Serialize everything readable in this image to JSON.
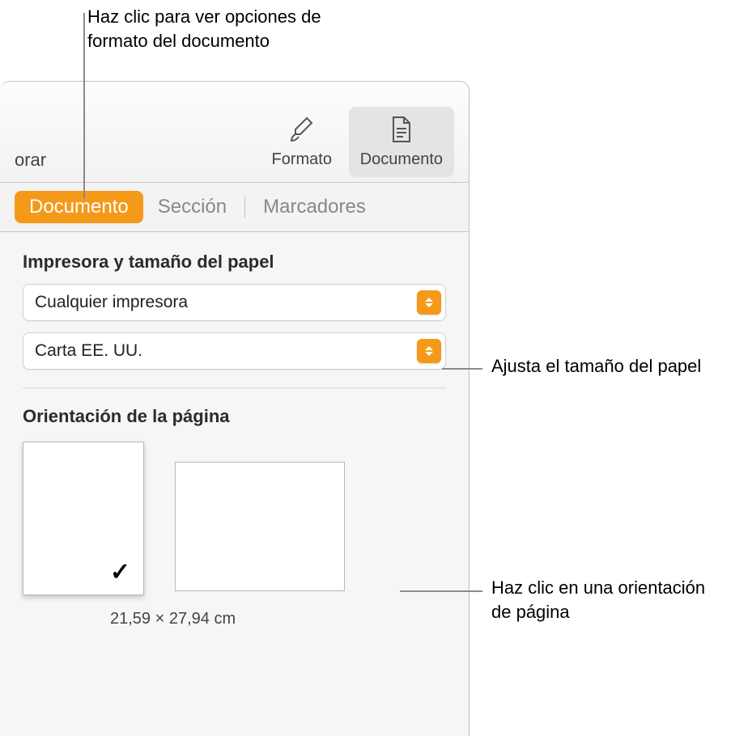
{
  "callouts": {
    "top": "Haz clic para ver opciones de formato del documento",
    "paper": "Ajusta el tamaño del papel",
    "orientation": "Haz clic en una orientación de página"
  },
  "toolbar": {
    "left_fragment": "orar",
    "format_label": "Formato",
    "document_label": "Documento"
  },
  "tabs": {
    "document": "Documento",
    "section": "Sección",
    "markers": "Marcadores"
  },
  "printer_section": {
    "title": "Impresora y tamaño del papel",
    "printer": "Cualquier impresora",
    "paper": "Carta EE. UU."
  },
  "orientation_section": {
    "title": "Orientación de la página",
    "dimensions": "21,59 × 27,94 cm"
  }
}
